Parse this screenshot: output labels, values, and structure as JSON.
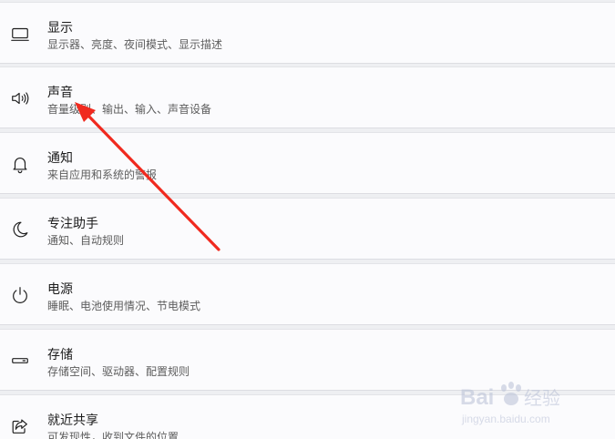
{
  "settings": {
    "items": [
      {
        "id": "display",
        "icon": "monitor-icon",
        "title": "显示",
        "subtitle": "显示器、亮度、夜间模式、显示描述"
      },
      {
        "id": "sound",
        "icon": "speaker-icon",
        "title": "声音",
        "subtitle": "音量级别、输出、输入、声音设备"
      },
      {
        "id": "notifications",
        "icon": "bell-icon",
        "title": "通知",
        "subtitle": "来自应用和系统的警报"
      },
      {
        "id": "focus-assist",
        "icon": "moon-icon",
        "title": "专注助手",
        "subtitle": "通知、自动规则"
      },
      {
        "id": "power",
        "icon": "power-icon",
        "title": "电源",
        "subtitle": "睡眠、电池使用情况、节电模式"
      },
      {
        "id": "storage",
        "icon": "drive-icon",
        "title": "存储",
        "subtitle": "存储空间、驱动器、配置规则"
      },
      {
        "id": "nearby-sharing",
        "icon": "share-icon",
        "title": "就近共享",
        "subtitle": "可发现性，收到文件的位置"
      }
    ]
  },
  "annotation": {
    "type": "red-arrow",
    "color": "#f02a1f",
    "points_to": "sound"
  },
  "watermark": {
    "text": "Baidu经验",
    "url_text": "jingyan.baidu.com"
  }
}
